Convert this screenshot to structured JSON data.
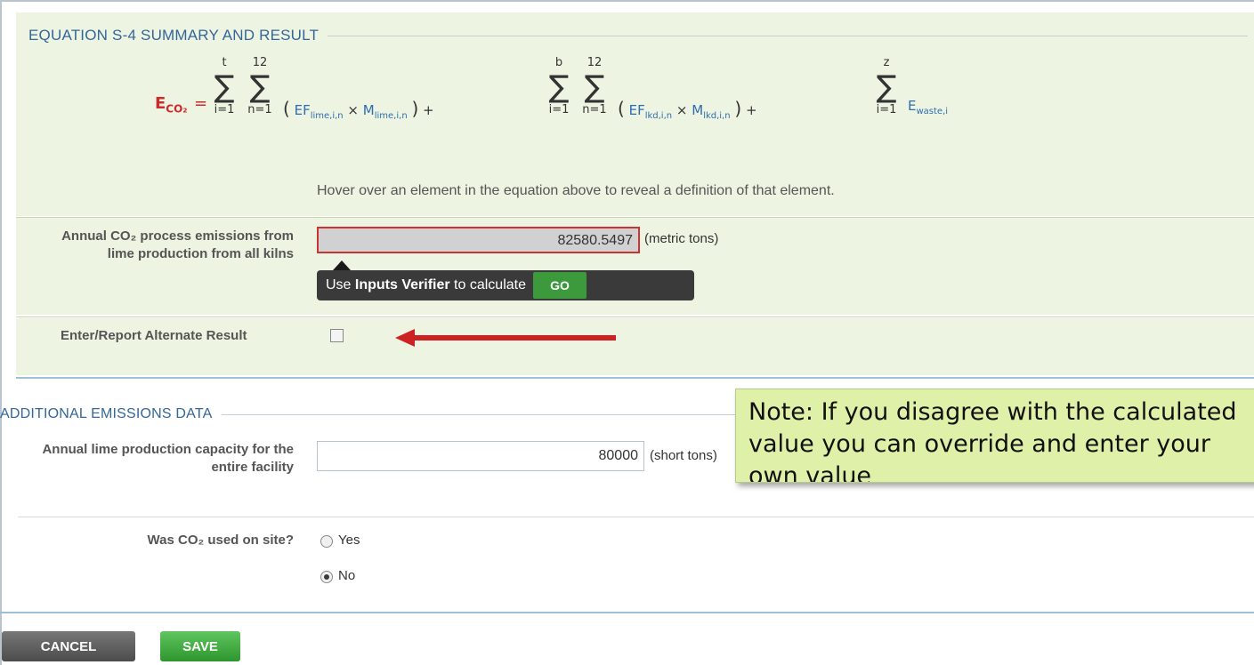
{
  "equation_section": {
    "title": "EQUATION S-4 SUMMARY AND RESULT",
    "lhs": "E",
    "lhs_sub": "CO₂",
    "equals": "=",
    "sums": [
      {
        "top": "t",
        "bottom": "i=1"
      },
      {
        "top": "12",
        "bottom": "n=1"
      },
      {
        "top": "b",
        "bottom": "i=1"
      },
      {
        "top": "12",
        "bottom": "n=1"
      },
      {
        "top": "z",
        "bottom": "i=1"
      }
    ],
    "terms": {
      "ef_lime": "EF",
      "ef_lime_sub": "lime,i,n",
      "m_lime": "M",
      "m_lime_sub": "lime,i,n",
      "ef_lkd": "EF",
      "ef_lkd_sub": "lkd,i,n",
      "m_lkd": "M",
      "m_lkd_sub": "lkd,i,n",
      "e_waste": "E",
      "e_waste_sub": "waste,i"
    },
    "hint": "Hover over an element in the equation above to reveal a definition of that element."
  },
  "result": {
    "label": "Annual CO₂ process emissions from lime production from all kilns",
    "value": "82580.5497",
    "unit": "(metric tons)",
    "verifier_prefix": "Use ",
    "verifier_bold": "Inputs Verifier",
    "verifier_suffix": " to calculate",
    "go_label": "GO"
  },
  "alternate": {
    "label": "Enter/Report Alternate Result",
    "checked": false
  },
  "additional": {
    "title": "ADDITIONAL EMISSIONS DATA",
    "capacity_label": "Annual lime production capacity for the entire facility",
    "capacity_value": "80000",
    "capacity_unit": "(short tons)",
    "co2_used_label": "Was CO₂ used on site?",
    "options": [
      "Yes",
      "No"
    ],
    "selected": "No"
  },
  "buttons": {
    "cancel": "CANCEL",
    "save": "SAVE"
  },
  "callout": {
    "text": "Note: If you disagree with the calculated value you can override and enter your own value"
  },
  "colors": {
    "section_bg": "#eef4e2",
    "title_blue": "#336699",
    "equation_red": "#cc2b2b",
    "equation_blue": "#2e6db0",
    "callout_bg": "#dff1a8",
    "arrow_red": "#cc2222",
    "go_green": "#3c9a3c"
  },
  "icons": {
    "arrow": "left-arrow-icon",
    "verifier_pointer": "triangle-up-icon"
  }
}
